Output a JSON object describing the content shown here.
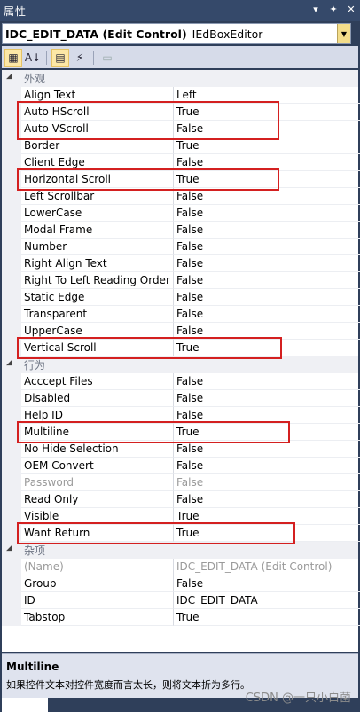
{
  "window": {
    "title": "属性",
    "buttons": [
      "▾",
      "✦",
      "✕"
    ]
  },
  "object_selector": {
    "name": "IDC_EDIT_DATA (Edit Control)",
    "type": "IEdBoxEditor"
  },
  "toolbar": {
    "buttons": [
      {
        "id": "categorized",
        "icon": "categorized-icon",
        "glyph": "▦",
        "active": true
      },
      {
        "id": "alphabetical",
        "icon": "alphabetical-sort-icon",
        "glyph": "A↓",
        "active": false
      },
      {
        "id": "properties",
        "icon": "properties-icon",
        "glyph": "▤",
        "active": true
      },
      {
        "id": "events",
        "icon": "lightning-icon",
        "glyph": "⚡",
        "active": false
      },
      {
        "id": "property-pages",
        "icon": "property-pages-icon",
        "glyph": "▭",
        "active": false,
        "disabled": true
      }
    ]
  },
  "grid": {
    "categories": [
      {
        "name": "外观",
        "properties": [
          {
            "name": "Align Text",
            "value": "Left"
          },
          {
            "name": "Auto HScroll",
            "value": "True"
          },
          {
            "name": "Auto VScroll",
            "value": "False"
          },
          {
            "name": "Border",
            "value": "True"
          },
          {
            "name": "Client Edge",
            "value": "False"
          },
          {
            "name": "Horizontal Scroll",
            "value": "True"
          },
          {
            "name": "Left Scrollbar",
            "value": "False"
          },
          {
            "name": "LowerCase",
            "value": "False"
          },
          {
            "name": "Modal Frame",
            "value": "False"
          },
          {
            "name": "Number",
            "value": "False"
          },
          {
            "name": "Right Align Text",
            "value": "False"
          },
          {
            "name": "Right To Left Reading Order",
            "value": "False"
          },
          {
            "name": "Static Edge",
            "value": "False"
          },
          {
            "name": "Transparent",
            "value": "False"
          },
          {
            "name": "UpperCase",
            "value": "False"
          },
          {
            "name": "Vertical Scroll",
            "value": "True"
          }
        ]
      },
      {
        "name": "行为",
        "properties": [
          {
            "name": "Acccept Files",
            "value": "False"
          },
          {
            "name": "Disabled",
            "value": "False"
          },
          {
            "name": "Help ID",
            "value": "False"
          },
          {
            "name": "Multiline",
            "value": "True"
          },
          {
            "name": "No Hide Selection",
            "value": "False"
          },
          {
            "name": "OEM Convert",
            "value": "False"
          },
          {
            "name": "Password",
            "value": "False",
            "disabled": true
          },
          {
            "name": "Read Only",
            "value": "False"
          },
          {
            "name": "Visible",
            "value": "True"
          },
          {
            "name": "Want Return",
            "value": "True"
          }
        ]
      },
      {
        "name": "杂项",
        "properties": [
          {
            "name": "(Name)",
            "value": "IDC_EDIT_DATA (Edit Control)",
            "disabled": true
          },
          {
            "name": "Group",
            "value": "False"
          },
          {
            "name": "ID",
            "value": "IDC_EDIT_DATA"
          },
          {
            "name": "Tabstop",
            "value": "True"
          }
        ]
      }
    ],
    "highlighted": [
      "Auto HScroll",
      "Auto VScroll",
      "Horizontal Scroll",
      "Vertical Scroll",
      "Multiline",
      "Want Return"
    ]
  },
  "description": {
    "title": "Multiline",
    "text": "如果控件文本对控件宽度而言太长，则将文本折为多行。"
  },
  "watermark": "CSDN @一只小白菌",
  "colors": {
    "titlebar": "#35496a",
    "highlight_border": "#d42020",
    "category_bg": "#eff0f4"
  }
}
